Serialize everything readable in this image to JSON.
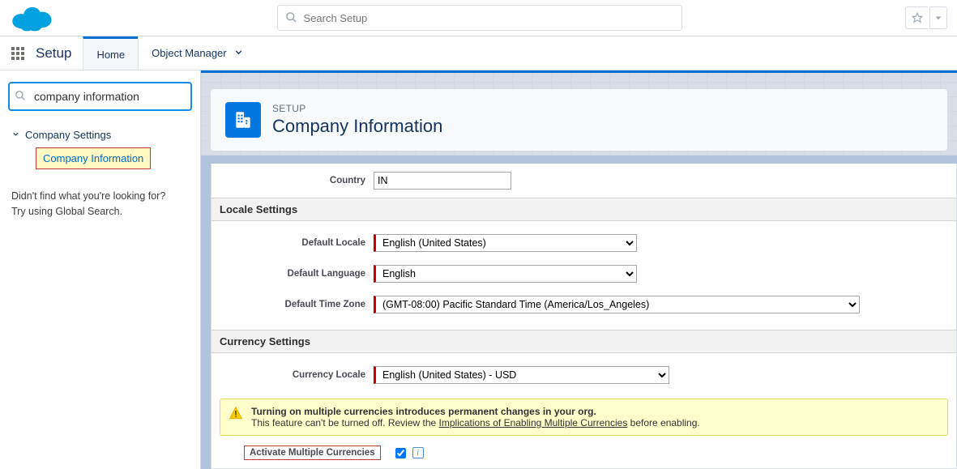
{
  "globalSearch": {
    "placeholder": "Search Setup"
  },
  "app": {
    "name": "Setup"
  },
  "navTabs": {
    "home": "Home",
    "objectManager": "Object Manager"
  },
  "sidebar": {
    "quickFind": "company information",
    "section": {
      "label": "Company Settings"
    },
    "item": {
      "label": "Company Information"
    },
    "help1": "Didn't find what you're looking for?",
    "help2": "Try using Global Search."
  },
  "page": {
    "crumb": "SETUP",
    "title": "Company Information"
  },
  "fields": {
    "countryLabel": "Country",
    "countryValue": "IN",
    "localeSection": "Locale Settings",
    "defaultLocaleLabel": "Default Locale",
    "defaultLocaleValue": "English (United States)",
    "defaultLanguageLabel": "Default Language",
    "defaultLanguageValue": "English",
    "defaultTimeZoneLabel": "Default Time Zone",
    "defaultTimeZoneValue": "(GMT-08:00) Pacific Standard Time (America/Los_Angeles)",
    "currencySection": "Currency Settings",
    "currencyLocaleLabel": "Currency Locale",
    "currencyLocaleValue": "English (United States) - USD"
  },
  "warning": {
    "line1": "Turning on multiple currencies introduces permanent changes in your org.",
    "line2a": "This feature can't be turned off. Review the ",
    "link": "Implications of Enabling Multiple Currencies",
    "line2b": " before enabling."
  },
  "activateLabel": "Activate Multiple Currencies"
}
